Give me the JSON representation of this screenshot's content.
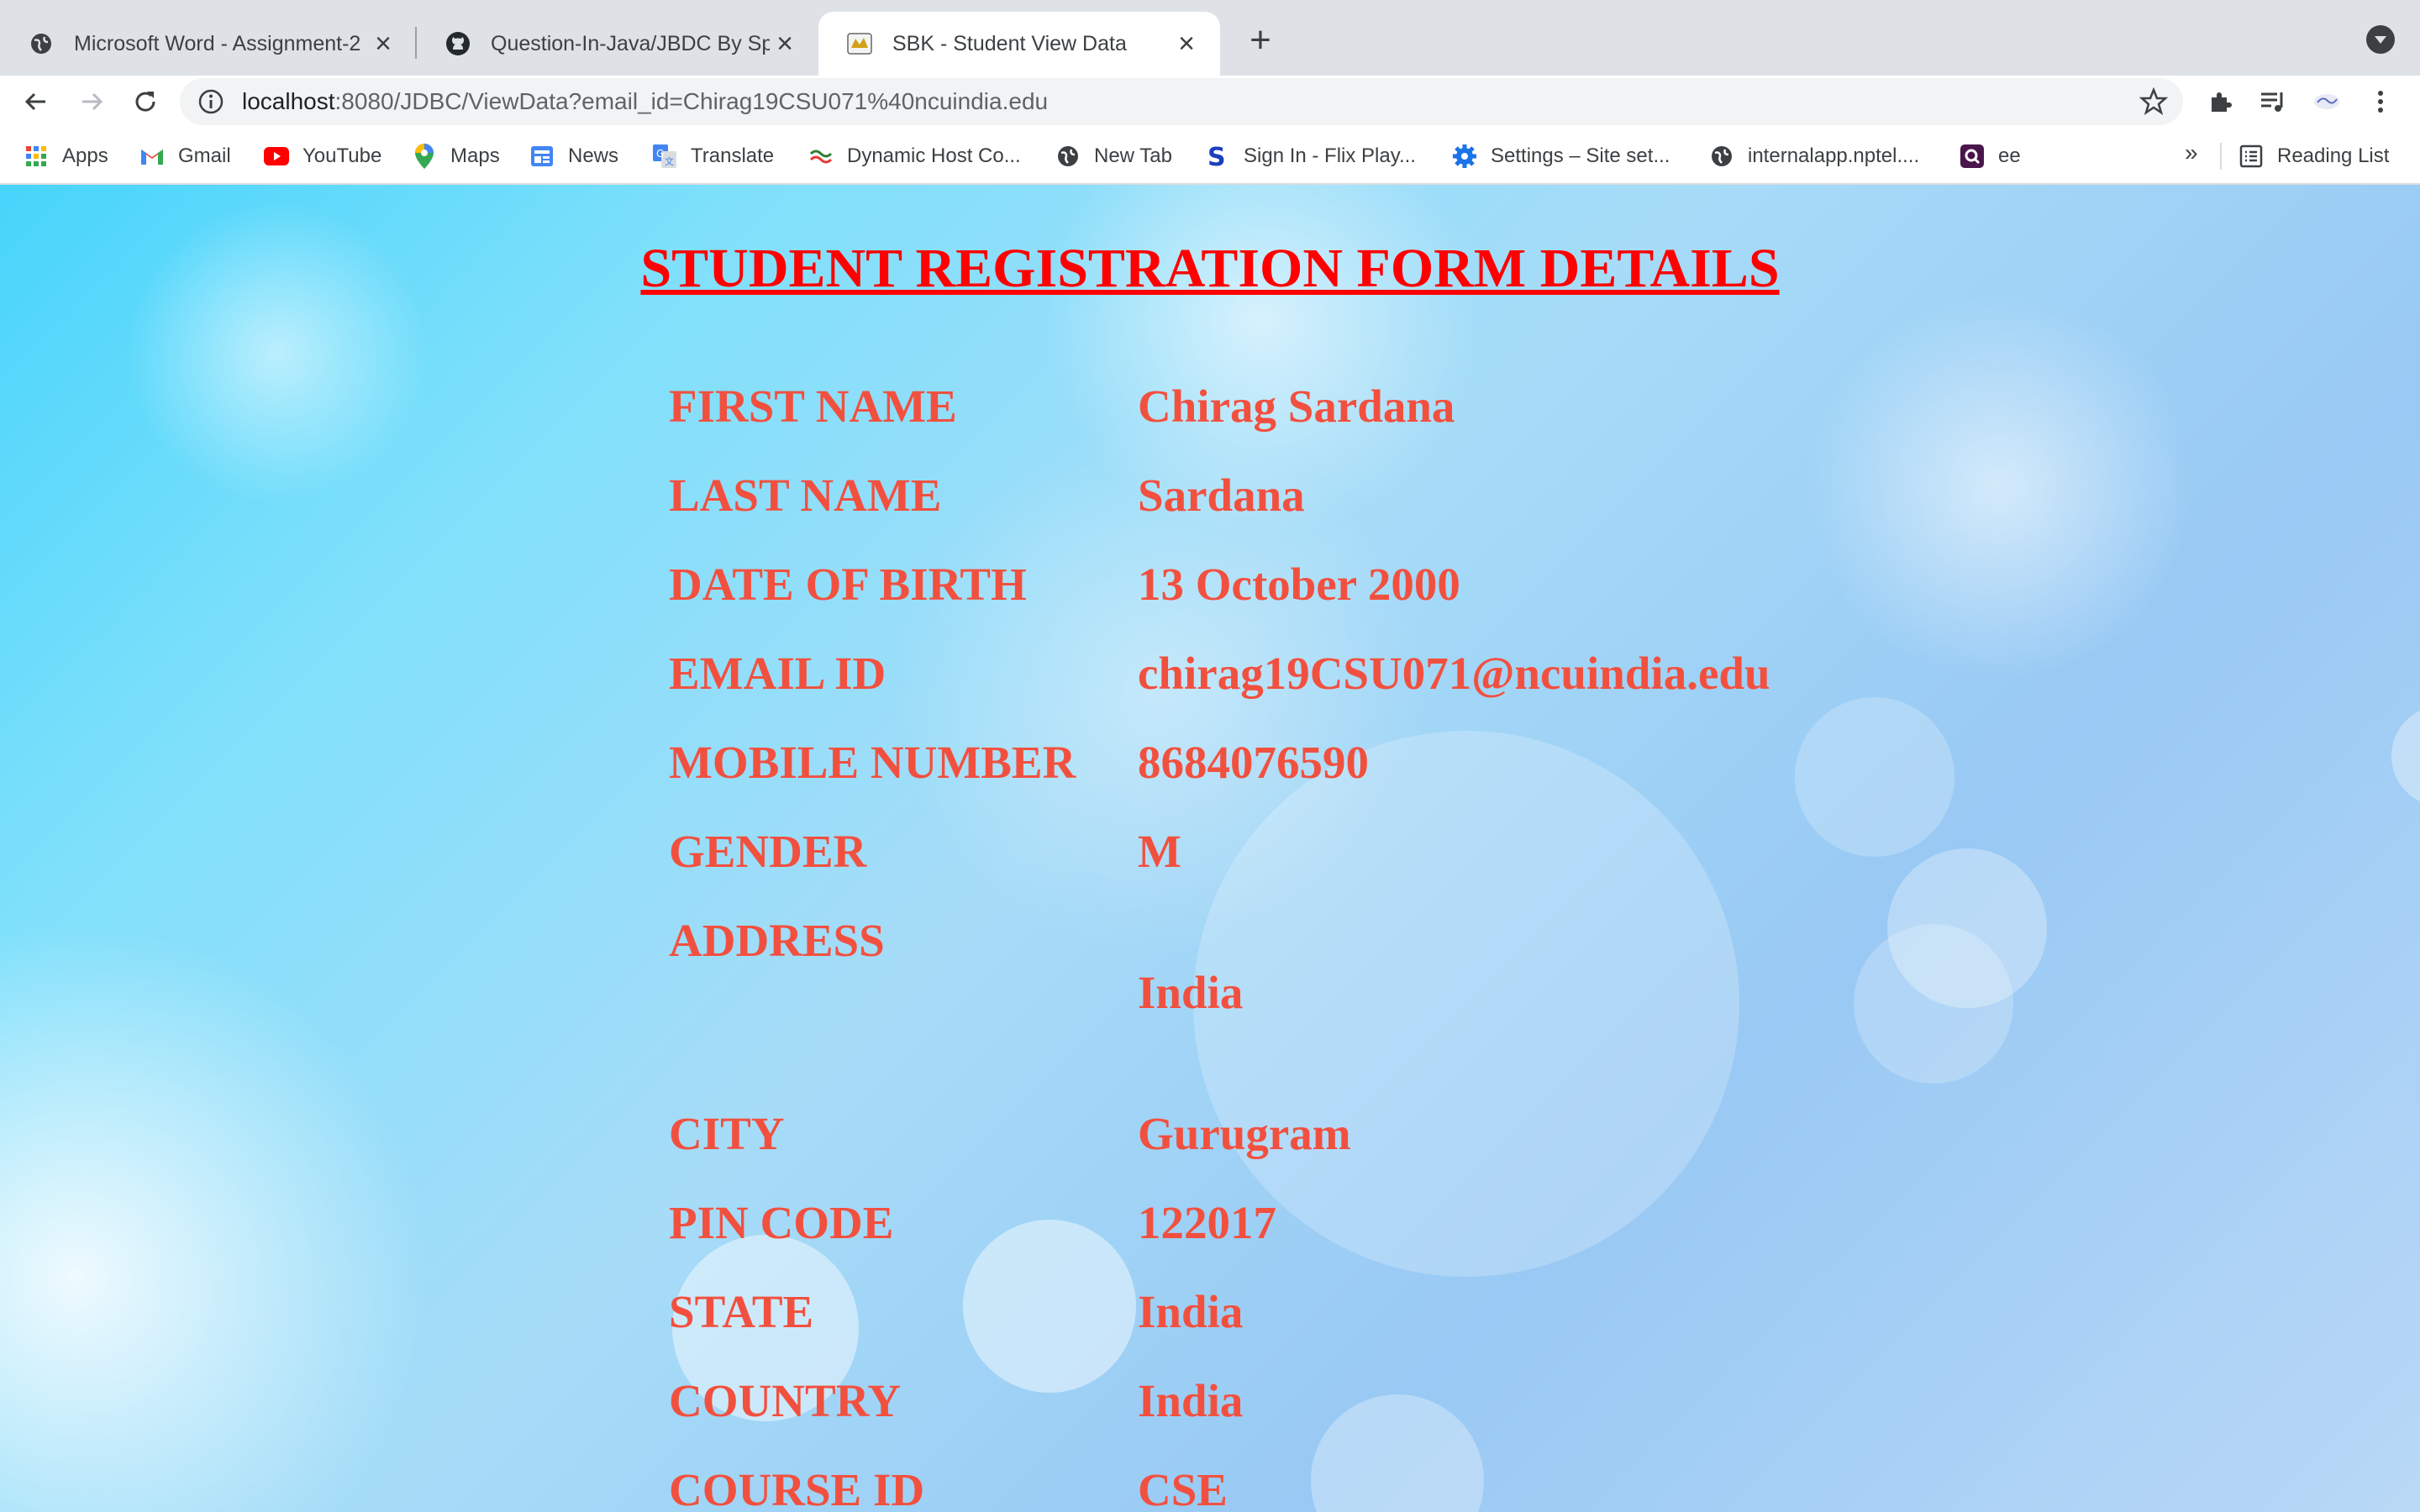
{
  "tabs": [
    {
      "title": "Microsoft Word - Assignment-2",
      "active": false,
      "icon": "globe-icon"
    },
    {
      "title": "Question-In-Java/JBDC By Sprin",
      "active": false,
      "icon": "github-icon"
    },
    {
      "title": "SBK - Student View Data",
      "active": true,
      "icon": "tomcat-icon"
    }
  ],
  "address_bar": {
    "host": "localhost",
    "path": ":8080/JDBC/ViewData?email_id=Chirag19CSU071%40ncuindia.edu"
  },
  "bookmarks": [
    {
      "label": "Apps",
      "icon": "apps-grid-icon"
    },
    {
      "label": "Gmail",
      "icon": "gmail-icon"
    },
    {
      "label": "YouTube",
      "icon": "youtube-icon"
    },
    {
      "label": "Maps",
      "icon": "maps-pin-icon"
    },
    {
      "label": "News",
      "icon": "news-icon"
    },
    {
      "label": "Translate",
      "icon": "translate-icon"
    },
    {
      "label": "Dynamic Host Co...",
      "icon": "dynamic-host-icon"
    },
    {
      "label": "New Tab",
      "icon": "globe-icon"
    },
    {
      "label": "Sign In - Flix Play...",
      "icon": "flix-s-icon"
    },
    {
      "label": "Settings – Site set...",
      "icon": "gear-icon"
    },
    {
      "label": "internalapp.nptel....",
      "icon": "globe-icon"
    },
    {
      "label": "ee",
      "icon": "ee-icon"
    }
  ],
  "bookmarks_overflow": "»",
  "reading_list": "Reading List",
  "page": {
    "heading": "STUDENT REGISTRATION FORM DETAILS",
    "fields": [
      {
        "label": "FIRST NAME",
        "value": "Chirag Sardana"
      },
      {
        "label": "LAST NAME",
        "value": "Sardana"
      },
      {
        "label": "DATE OF BIRTH",
        "value": "13 October 2000"
      },
      {
        "label": "EMAIL ID",
        "value": "chirag19CSU071@ncuindia.edu"
      },
      {
        "label": "MOBILE NUMBER",
        "value": "8684076590"
      },
      {
        "label": "GENDER",
        "value": "M"
      },
      {
        "label": "ADDRESS",
        "value": "India"
      },
      {
        "label": "CITY",
        "value": "Gurugram"
      },
      {
        "label": "PIN CODE",
        "value": "122017"
      },
      {
        "label": "STATE",
        "value": "India"
      },
      {
        "label": "COUNTRY",
        "value": "India"
      },
      {
        "label": "COURSE ID",
        "value": "CSE"
      }
    ]
  },
  "colors": {
    "heading": "#ff0000",
    "field_text": "#f2503f",
    "tabstrip": "#dee1e6"
  }
}
